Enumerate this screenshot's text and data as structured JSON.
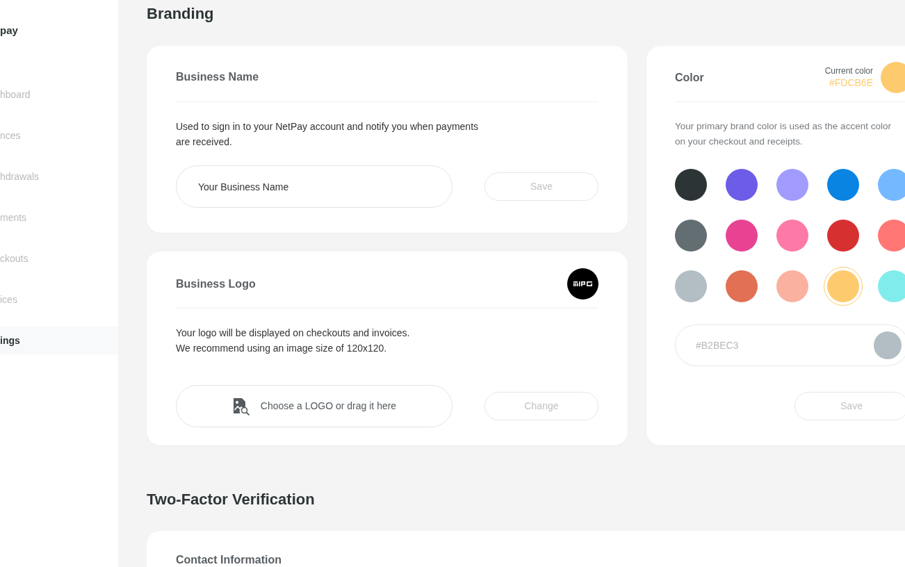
{
  "sidebar": {
    "brand": "pay",
    "items": [
      {
        "label": "hboard",
        "selected": false
      },
      {
        "label": "nces",
        "selected": false
      },
      {
        "label": "hdrawals",
        "selected": false
      },
      {
        "label": "ments",
        "selected": false
      },
      {
        "label": "ckouts",
        "selected": false
      },
      {
        "label": "ices",
        "selected": false
      },
      {
        "label": "ings",
        "selected": true
      }
    ]
  },
  "branding": {
    "heading": "Branding",
    "business_name": {
      "title": "Business Name",
      "description": "Used to sign in to your NetPay account and notify you when payments are received.",
      "input": {
        "value": "Your Business Name"
      },
      "button": "Save"
    },
    "business_logo": {
      "title": "Business Logo",
      "description_lines": [
        "Your logo will be displayed on checkouts and invoices.",
        "We recommend using an image size of 120x120."
      ],
      "upload": {
        "label": "Choose a LOGO or drag it here"
      },
      "button": "Change"
    },
    "color": {
      "title": "Color",
      "current": {
        "label": "Current color",
        "value": "#FDCB6E",
        "color": "#fdcb6e"
      },
      "description": "Your primary brand color is used as the accent color on your checkout and receipts.",
      "swatches": [
        {
          "color": "#2d3436",
          "selected": false
        },
        {
          "color": "#6c5ce7",
          "selected": false
        },
        {
          "color": "#a29bfe",
          "selected": false
        },
        {
          "color": "#0984e3",
          "selected": false
        },
        {
          "color": "#74b9ff",
          "selected": false
        },
        {
          "color": "#636e72",
          "selected": false
        },
        {
          "color": "#e84393",
          "selected": false
        },
        {
          "color": "#fd79a8",
          "selected": false
        },
        {
          "color": "#d63031",
          "selected": false
        },
        {
          "color": "#ff7675",
          "selected": false
        },
        {
          "color": "#b2bec3",
          "selected": false
        },
        {
          "color": "#e17055",
          "selected": false
        },
        {
          "color": "#fab1a0",
          "selected": false
        },
        {
          "color": "#fdcb6e",
          "selected": true
        },
        {
          "color": "#81ecec",
          "selected": false
        }
      ],
      "hex_input": {
        "placeholder": "#B2BEC3",
        "color": "#b2bec3"
      },
      "button": "Save"
    }
  },
  "two_factor": {
    "heading": "Two-Factor Verification",
    "card": {
      "title": "Contact Information"
    }
  }
}
